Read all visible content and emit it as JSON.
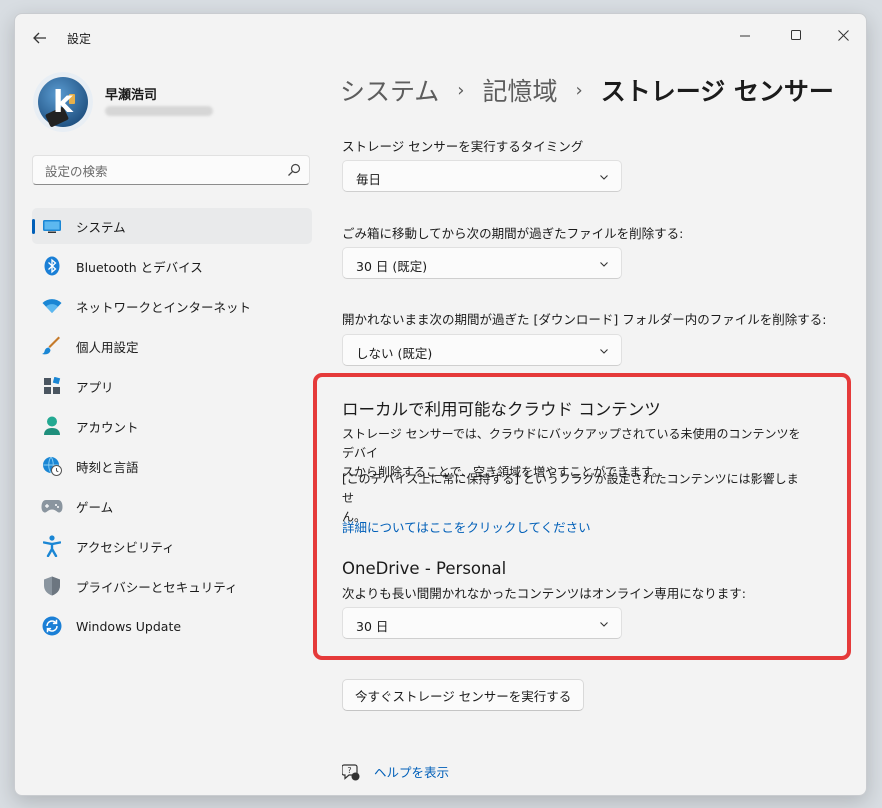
{
  "window": {
    "title": "設定"
  },
  "profile": {
    "name": "早瀬浩司",
    "avatar_letter": "k"
  },
  "search": {
    "placeholder": "設定の検索"
  },
  "nav": {
    "items": [
      {
        "label": "システム",
        "icon": "system-display-icon",
        "selected": true
      },
      {
        "label": "Bluetooth とデバイス",
        "icon": "bluetooth-icon"
      },
      {
        "label": "ネットワークとインターネット",
        "icon": "wifi-icon"
      },
      {
        "label": "個人用設定",
        "icon": "brush-icon"
      },
      {
        "label": "アプリ",
        "icon": "apps-icon"
      },
      {
        "label": "アカウント",
        "icon": "account-icon"
      },
      {
        "label": "時刻と言語",
        "icon": "globe-clock-icon"
      },
      {
        "label": "ゲーム",
        "icon": "gamepad-icon"
      },
      {
        "label": "アクセシビリティ",
        "icon": "accessibility-icon"
      },
      {
        "label": "プライバシーとセキュリティ",
        "icon": "shield-icon"
      },
      {
        "label": "Windows Update",
        "icon": "windows-update-icon"
      }
    ]
  },
  "breadcrumb": {
    "items": [
      "システム",
      "記憶域",
      "ストレージ センサー"
    ]
  },
  "settings": {
    "timing_label": "ストレージ センサーを実行するタイミング",
    "timing_value": "毎日",
    "recycle_label": "ごみ箱に移動してから次の期間が過ぎたファイルを削除する:",
    "recycle_value": "30 日 (既定)",
    "downloads_label": "開かれないまま次の期間が過ぎた [ダウンロード] フォルダー内のファイルを削除する:",
    "downloads_value": "しない (既定)"
  },
  "cloud": {
    "title": "ローカルで利用可能なクラウド コンテンツ",
    "desc_line1": "ストレージ センサーでは、クラウドにバックアップされている未使用のコンテンツをデバイ",
    "desc_line2": "スから削除することで、空き領域を増やすことができます。",
    "note_line1": "[このデバイス上に常に保持する] というフラグが設定されたコンテンツには影響しませ",
    "note_line2": "ん。",
    "link": "詳細についてはここをクリックしてください",
    "onedrive_title": "OneDrive - Personal",
    "onedrive_label": "次よりも長い間開かれなかったコンテンツはオンライン専用になります:",
    "onedrive_value": "30 日"
  },
  "actions": {
    "run_now": "今すぐストレージ センサーを実行する"
  },
  "help": {
    "label": "ヘルプを表示"
  },
  "colors": {
    "accent": "#005fb8",
    "highlight": "#e53a3a",
    "window_bg": "#f3f3f3"
  }
}
